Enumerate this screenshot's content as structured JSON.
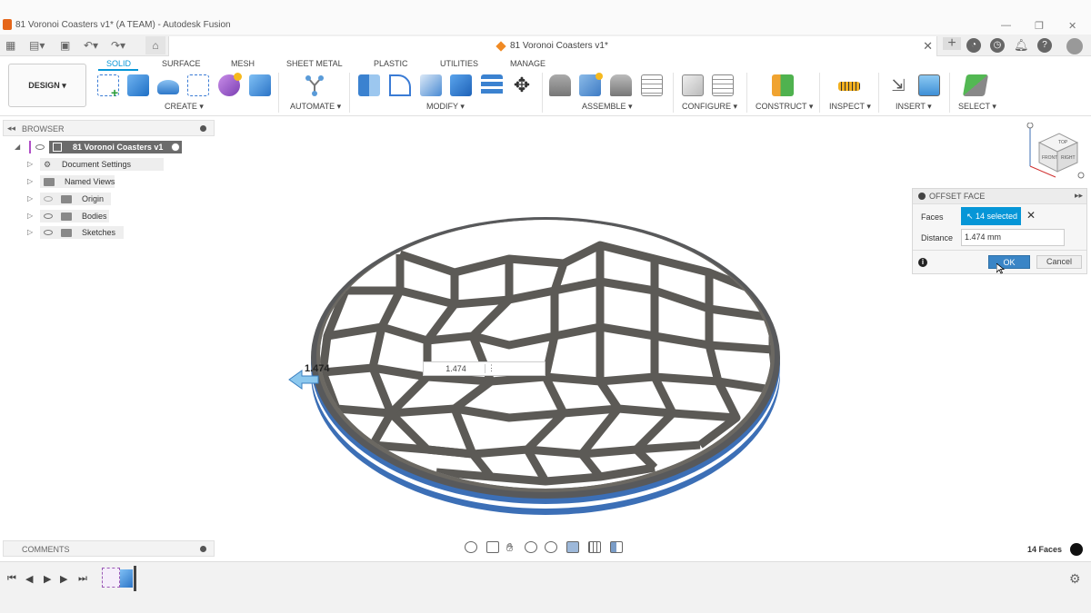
{
  "window": {
    "title": "81 Voronoi Coasters v1* (A TEAM) - Autodesk Fusion",
    "minimize": "—",
    "maximize": "❐",
    "close": "✕"
  },
  "doc_tab": {
    "title": "81 Voronoi Coasters v1*",
    "close": "✕"
  },
  "workspace": {
    "label": "DESIGN ▾"
  },
  "ribbon": {
    "tabs": [
      "SOLID",
      "SURFACE",
      "MESH",
      "SHEET METAL",
      "PLASTIC",
      "UTILITIES",
      "MANAGE"
    ],
    "active_tab": "SOLID",
    "groups": [
      "CREATE ▾",
      "AUTOMATE ▾",
      "MODIFY ▾",
      "ASSEMBLE ▾",
      "CONFIGURE ▾",
      "CONSTRUCT ▾",
      "INSPECT ▾",
      "INSERT ▾",
      "SELECT ▾"
    ]
  },
  "browser": {
    "label": "BROWSER",
    "root": "81 Voronoi Coasters v1",
    "items": [
      "Document Settings",
      "Named Views",
      "Origin",
      "Bodies",
      "Sketches"
    ]
  },
  "offset_face": {
    "title": "OFFSET FACE",
    "faces_label": "Faces",
    "faces_value": "14 selected",
    "distance_label": "Distance",
    "distance_value": "1.474 mm",
    "ok": "OK",
    "cancel": "Cancel"
  },
  "viewport": {
    "dim_label": "1.474",
    "dim_input": "1.474",
    "face_count": "14 Faces",
    "view_cube": {
      "top": "TOP",
      "front": "FRONT",
      "right": "RIGHT"
    }
  },
  "comments": {
    "label": "COMMENTS"
  },
  "colors": {
    "accent": "#0696d7",
    "body_gray": "#6b6862",
    "face_blue": "#3c6fb6"
  }
}
